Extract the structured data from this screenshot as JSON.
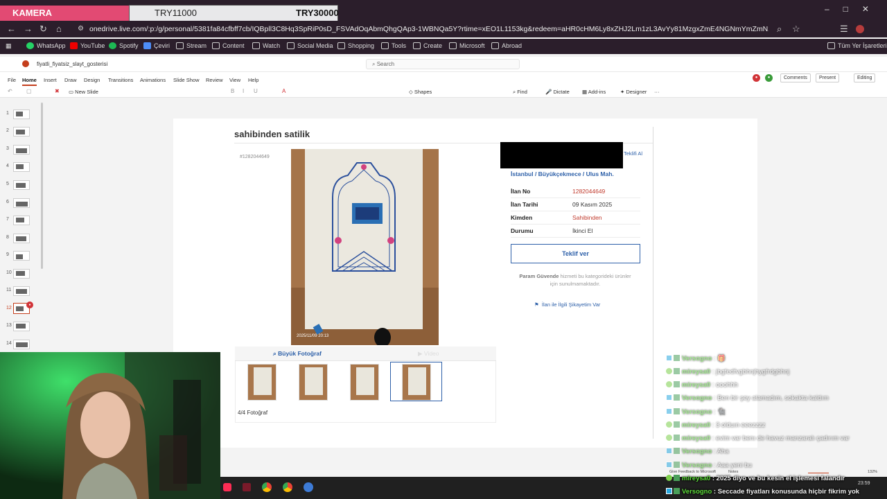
{
  "overlay": {
    "camera_label": "KAMERA",
    "goal_current": "TRY11000",
    "goal_target": "TRY30000"
  },
  "browser": {
    "url": "onedrive.live.com/:p:/g/personal/5381fa84cfbff7cb/IQBpll3C8Hq3SpRiP0sD_FSVAdOqAbmQhgQAp3-1WBNQa5Y?rtime=xEO1L1153kg&redeem=aHR0cHM6Ly8xZHJ2Lm1zL3AvYy81MzgxZmE4NGNmYmZmN2NiL0lRQnBsSTNDOEhxM1Nw...",
    "bookmarks": [
      "WhatsApp",
      "YouTube",
      "Spotify",
      "Çeviri",
      "Stream",
      "Content",
      "Watch",
      "Social Media",
      "Shopping",
      "Tools",
      "Create",
      "Microsoft",
      "Abroad"
    ],
    "all_bookmarks": "Tüm Yer İşaretleri"
  },
  "ppt": {
    "file_name": "fiyatli_fiyatsiz_slayt_gosterisi",
    "search_placeholder": "Search",
    "tabs": [
      "File",
      "Home",
      "Insert",
      "Draw",
      "Design",
      "Transitions",
      "Animations",
      "Slide Show",
      "Review",
      "View",
      "Help"
    ],
    "ribbon": {
      "new_slide": "New Slide",
      "shapes": "Shapes",
      "find": "Find",
      "dictate": "Dictate",
      "addins": "Add-ins",
      "designer": "Designer"
    },
    "right": {
      "comments": "Comments",
      "present": "Present",
      "editing": "Editing"
    },
    "slide_numbers": [
      "1",
      "2",
      "3",
      "4",
      "5",
      "6",
      "7",
      "8",
      "9",
      "10",
      "11",
      "12",
      "13",
      "14"
    ],
    "selected_slide": "12"
  },
  "slide": {
    "title": "sahibinden satilik",
    "listing_id_tag": "#1282044649",
    "teklifi_al": "Teklifi Al",
    "breadcrumb": "İstanbul  /  Büyükçekmece  /  Ulus Mah.",
    "info": [
      {
        "label": "İlan No",
        "value": "1282044649",
        "red": true
      },
      {
        "label": "İlan Tarihi",
        "value": "09 Kasım 2025",
        "red": false
      },
      {
        "label": "Kimden",
        "value": "Sahibinden",
        "red": true
      },
      {
        "label": "Durumu",
        "value": "İkinci El",
        "red": false
      }
    ],
    "offer_button": "Teklif ver",
    "param_bold": "Param Güvende",
    "param_rest": "hizmeti bu kategorideki ürünler için sunulmamaktadır.",
    "complaint": "İlan ile İlgili Şikayetim Var",
    "photo_timestamp": "2025/11/09 20:13",
    "big_photo_tab": "Büyük Fotoğraf",
    "video_tab": "Video",
    "photo_count": "4/4 Fotoğraf"
  },
  "chat": [
    {
      "user": "Versogno",
      "msg": "🎁",
      "faded": true,
      "type": "a"
    },
    {
      "user": "mireysa0",
      "msg": "jbgfedfvgbhnjhygfrdgbhnj",
      "faded": true,
      "type": "b"
    },
    {
      "user": "mireysa0",
      "msg": "ooohhh",
      "faded": true,
      "type": "b"
    },
    {
      "user": "Versogno",
      "msg": "Ben bir şey alamadım, sokakta kaldım",
      "faded": true,
      "type": "a"
    },
    {
      "user": "Versogno",
      "msg": "🐈‍⬛",
      "faded": true,
      "type": "a"
    },
    {
      "user": "mireysa0",
      "msg": "3 olduın eeezzzz",
      "faded": true,
      "type": "b"
    },
    {
      "user": "mireysa0",
      "msg": "evim var benı de havuz manzaralı çadırım var",
      "faded": true,
      "type": "b"
    },
    {
      "user": "Versogno",
      "msg": "Aha",
      "faded": true,
      "type": "a"
    },
    {
      "user": "Versogno",
      "msg": "Aaa yeni bu",
      "faded": true,
      "type": "a"
    },
    {
      "user": "mireysa0",
      "msg": "2025 diyo ve bu kesin el işlemesi falandır",
      "faded": false,
      "type": "b"
    },
    {
      "user": "Versogno",
      "msg": "Seccade fiyatları konusunda hiçbir fikrim yok",
      "faded": false,
      "type": "a"
    }
  ],
  "status": {
    "feedback": "Give Feedback to Microsoft",
    "notes": "Notes",
    "zoom": "132%",
    "clock": "23:59"
  },
  "colors": {
    "accent": "#c43e1c",
    "link": "#2c5fa8",
    "chat_user": "#5dde3a"
  }
}
